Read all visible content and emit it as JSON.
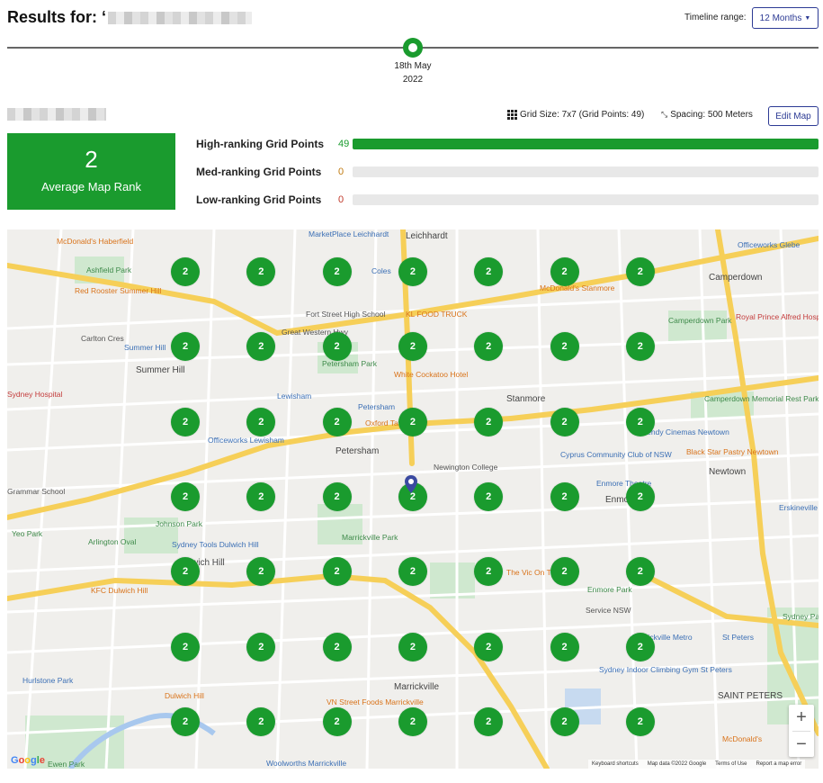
{
  "header": {
    "results_prefix": "Results for: ‘",
    "timeline_label": "Timeline range:",
    "range_value": "12 Months"
  },
  "timeline": {
    "date_line1": "18th May",
    "date_line2": "2022"
  },
  "grid_info": {
    "grid_size": "Grid Size: 7x7 (Grid Points: 49)",
    "spacing": "Spacing: 500 Meters",
    "edit_map_label": "Edit Map"
  },
  "rank_card": {
    "value": "2",
    "label": "Average Map Rank"
  },
  "stats": [
    {
      "label": "High-ranking Grid Points",
      "count": "49",
      "fraction": 1.0,
      "color": "#1a9b2e"
    },
    {
      "label": "Med-ranking Grid Points",
      "count": "0",
      "fraction": 0.0,
      "color": "#c07a10"
    },
    {
      "label": "Low-ranking Grid Points",
      "count": "0",
      "fraction": 0.0,
      "color": "#c0392b"
    }
  ],
  "grid": {
    "rows": 7,
    "cols": 7,
    "rank_value": "2"
  },
  "map_labels": [
    {
      "text": "McDonald's Haberfield",
      "cls": "orange"
    },
    {
      "text": "Ashfield Park",
      "cls": "green"
    },
    {
      "text": "Red Rooster Summer Hill",
      "cls": "orange"
    },
    {
      "text": "Carlton Cres",
      "cls": ""
    },
    {
      "text": "Summer Hill",
      "cls": "blue"
    },
    {
      "text": "Summer Hill",
      "cls": "big"
    },
    {
      "text": "Sydney Hospital",
      "cls": "red"
    },
    {
      "text": "Grammar School",
      "cls": ""
    },
    {
      "text": "Johnson Park",
      "cls": "green"
    },
    {
      "text": "Yeo Park",
      "cls": "green"
    },
    {
      "text": "Arlington Oval",
      "cls": "green"
    },
    {
      "text": "Sydney Tools Dulwich Hill",
      "cls": "blue"
    },
    {
      "text": "Dulwich Hill",
      "cls": "big"
    },
    {
      "text": "KFC Dulwich Hill",
      "cls": "orange"
    },
    {
      "text": "Hurlstone Park",
      "cls": "blue"
    },
    {
      "text": "Dulwich Hill",
      "cls": "orange"
    },
    {
      "text": "Ewen Park",
      "cls": "green"
    },
    {
      "text": "MarketPlace Leichhardt",
      "cls": "blue"
    },
    {
      "text": "Leichhardt",
      "cls": "big"
    },
    {
      "text": "Coles",
      "cls": "blue"
    },
    {
      "text": "Fort Street High School",
      "cls": ""
    },
    {
      "text": "KL FOOD TRUCK",
      "cls": "orange"
    },
    {
      "text": "Great Western Hwy",
      "cls": ""
    },
    {
      "text": "Petersham Park",
      "cls": "green"
    },
    {
      "text": "White Cockatoo Hotel",
      "cls": "orange"
    },
    {
      "text": "Lewisham",
      "cls": "blue"
    },
    {
      "text": "Petersham",
      "cls": "blue"
    },
    {
      "text": "Oxford Tavern",
      "cls": "orange"
    },
    {
      "text": "Officeworks Lewisham",
      "cls": "blue"
    },
    {
      "text": "Petersham",
      "cls": "big"
    },
    {
      "text": "Marrickville Park",
      "cls": "green"
    },
    {
      "text": "Marrickville",
      "cls": "big"
    },
    {
      "text": "VN Street Foods Marrickville",
      "cls": "orange"
    },
    {
      "text": "Woolworths Marrickville",
      "cls": "blue"
    },
    {
      "text": "Stanmore",
      "cls": "big"
    },
    {
      "text": "Newington College",
      "cls": ""
    },
    {
      "text": "Cyprus Community Club of NSW",
      "cls": "blue"
    },
    {
      "text": "Enmore Theatre",
      "cls": "blue"
    },
    {
      "text": "Enmore",
      "cls": "big"
    },
    {
      "text": "Enmore Park",
      "cls": "green"
    },
    {
      "text": "The Vic On The Park",
      "cls": "orange"
    },
    {
      "text": "Service NSW",
      "cls": ""
    },
    {
      "text": "Marrickville Metro",
      "cls": "blue"
    },
    {
      "text": "Sydney Indoor Climbing Gym St Peters",
      "cls": "blue"
    },
    {
      "text": "SAINT PETERS",
      "cls": "big"
    },
    {
      "text": "Camperdown",
      "cls": "big"
    },
    {
      "text": "Camperdown Park",
      "cls": "green"
    },
    {
      "text": "Royal Prince Alfred Hospital",
      "cls": "red"
    },
    {
      "text": "Camperdown Memorial Rest Park",
      "cls": "green"
    },
    {
      "text": "Dendy Cinemas Newtown",
      "cls": "blue"
    },
    {
      "text": "Black Star Pastry Newtown",
      "cls": "orange"
    },
    {
      "text": "Newtown",
      "cls": "big"
    },
    {
      "text": "Officeworks Glebe",
      "cls": "blue"
    },
    {
      "text": "McDonald's Stanmore",
      "cls": "orange"
    },
    {
      "text": "Sydney Park",
      "cls": "green"
    },
    {
      "text": "St Peters",
      "cls": "blue"
    },
    {
      "text": "McDonald's",
      "cls": "orange"
    },
    {
      "text": "Erskineville",
      "cls": "blue"
    }
  ],
  "map_footer": {
    "logo": [
      "G",
      "o",
      "o",
      "g",
      "l",
      "e"
    ],
    "attributions": [
      "Keyboard shortcuts",
      "Map data ©2022 Google",
      "Terms of Use",
      "Report a map error"
    ]
  },
  "zoom": {
    "plus": "+",
    "minus": "−"
  }
}
